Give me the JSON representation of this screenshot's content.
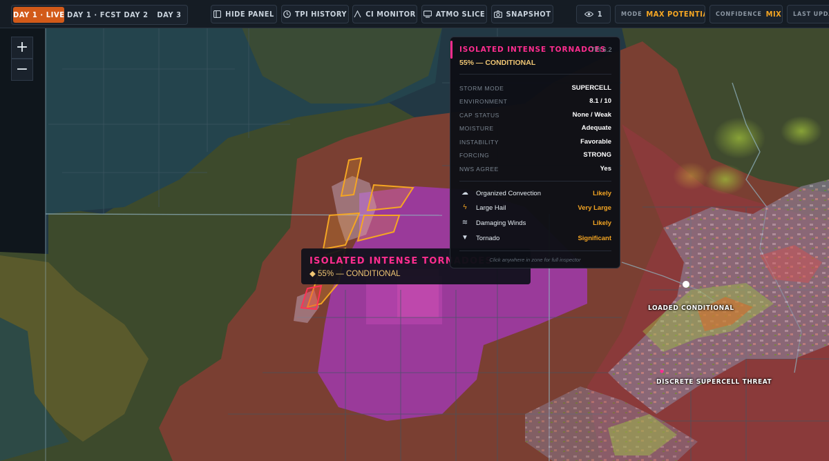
{
  "topbar": {
    "day_tabs": [
      "DAY 1 · LIVE",
      "DAY 1 · FCST",
      "DAY 2",
      "DAY 3"
    ],
    "buttons": [
      {
        "label": "HIDE PANEL",
        "icon": "panel-icon"
      },
      {
        "label": "TPI HISTORY",
        "icon": "clock-icon"
      },
      {
        "label": "CI MONITOR",
        "icon": "monitor-icon"
      },
      {
        "label": "ATMO SLICE",
        "icon": "layers-icon"
      },
      {
        "label": "SNAPSHOT",
        "icon": "camera-icon"
      }
    ],
    "eye_count": "1",
    "mode_label": "MODE",
    "mode_value": "MAX POTENTIAL",
    "confidence_label": "CONFIDENCE",
    "confidence_value": "MIXED",
    "last_update_label": "LAST UPDATE"
  },
  "zoom": {
    "in": "+",
    "out": "−"
  },
  "map_labels": {
    "loaded": "LOADED CONDITIONAL",
    "discrete": "DISCRETE SUPERCELL THREAT"
  },
  "tooltip": {
    "title": "ISOLATED INTENSE TORNADOES",
    "subtitle": "◆ 55% — CONDITIONAL"
  },
  "panel": {
    "title": "ISOLATED INTENSE TORNADOES",
    "tpi": "TPI 6.2",
    "probability": "55% — CONDITIONAL",
    "rows": [
      {
        "key": "STORM MODE",
        "value": "SUPERCELL"
      },
      {
        "key": "ENVIRONMENT",
        "value": "8.1 / 10"
      },
      {
        "key": "CAP STATUS",
        "value": "None / Weak"
      },
      {
        "key": "MOISTURE",
        "value": "Adequate"
      },
      {
        "key": "INSTABILITY",
        "value": "Favorable"
      },
      {
        "key": "FORCING",
        "value": "STRONG"
      },
      {
        "key": "NWS AGREE",
        "value": "Yes"
      }
    ],
    "hazards": [
      {
        "icon": "cloud-icon",
        "name": "Organized Convection",
        "value": "Likely"
      },
      {
        "icon": "lightning-icon",
        "name": "Large Hail",
        "value": "Very Large"
      },
      {
        "icon": "wind-icon",
        "name": "Damaging Winds",
        "value": "Likely"
      },
      {
        "icon": "tornado-icon",
        "name": "Tornado",
        "value": "Significant"
      }
    ],
    "footer": "Click anywhere in zone for full inspector"
  },
  "colors": {
    "accent_orange": "#d25a19",
    "magenta": "#ff2d8f",
    "amber": "#f5a623"
  }
}
